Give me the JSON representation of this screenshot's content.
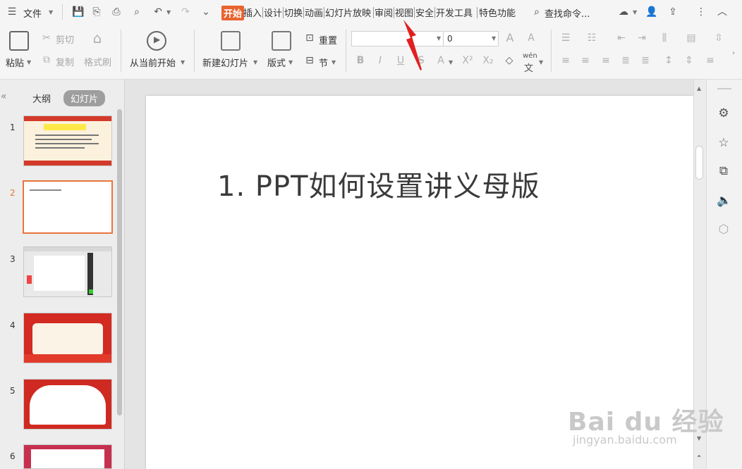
{
  "menubar": {
    "menu_label": "文件",
    "tabs": [
      "开始",
      "插入",
      "设计",
      "切换",
      "动画",
      "幻灯片放映",
      "审阅",
      "视图",
      "安全",
      "开发工具",
      "特色功能"
    ],
    "active_tab": "开始",
    "search_label": "查找命令..."
  },
  "ribbon": {
    "paste": "粘贴",
    "cut": "剪切",
    "copy": "复制",
    "format_painter": "格式刷",
    "start_current": "从当前开始",
    "new_slide": "新建幻灯片",
    "layout": "版式",
    "reset": "重置",
    "section": "节",
    "font_name": "",
    "font_size": "0",
    "wen_top": "wén",
    "wen_bottom": "文"
  },
  "leftpanel": {
    "tab_outline": "大纲",
    "tab_slides": "幻灯片",
    "active_tab": "幻灯片",
    "slide_numbers": [
      "1",
      "2",
      "3",
      "4",
      "5",
      "6"
    ],
    "selected_slide": "2"
  },
  "slide": {
    "title": "1.  PPT如何设置讲义母版"
  },
  "watermark": {
    "main": "Bai du 经验",
    "sub": "jingyan.baidu.com"
  },
  "colors": {
    "accent": "#e8632f",
    "selection": "#e8763a",
    "arrow": "#e02020"
  }
}
